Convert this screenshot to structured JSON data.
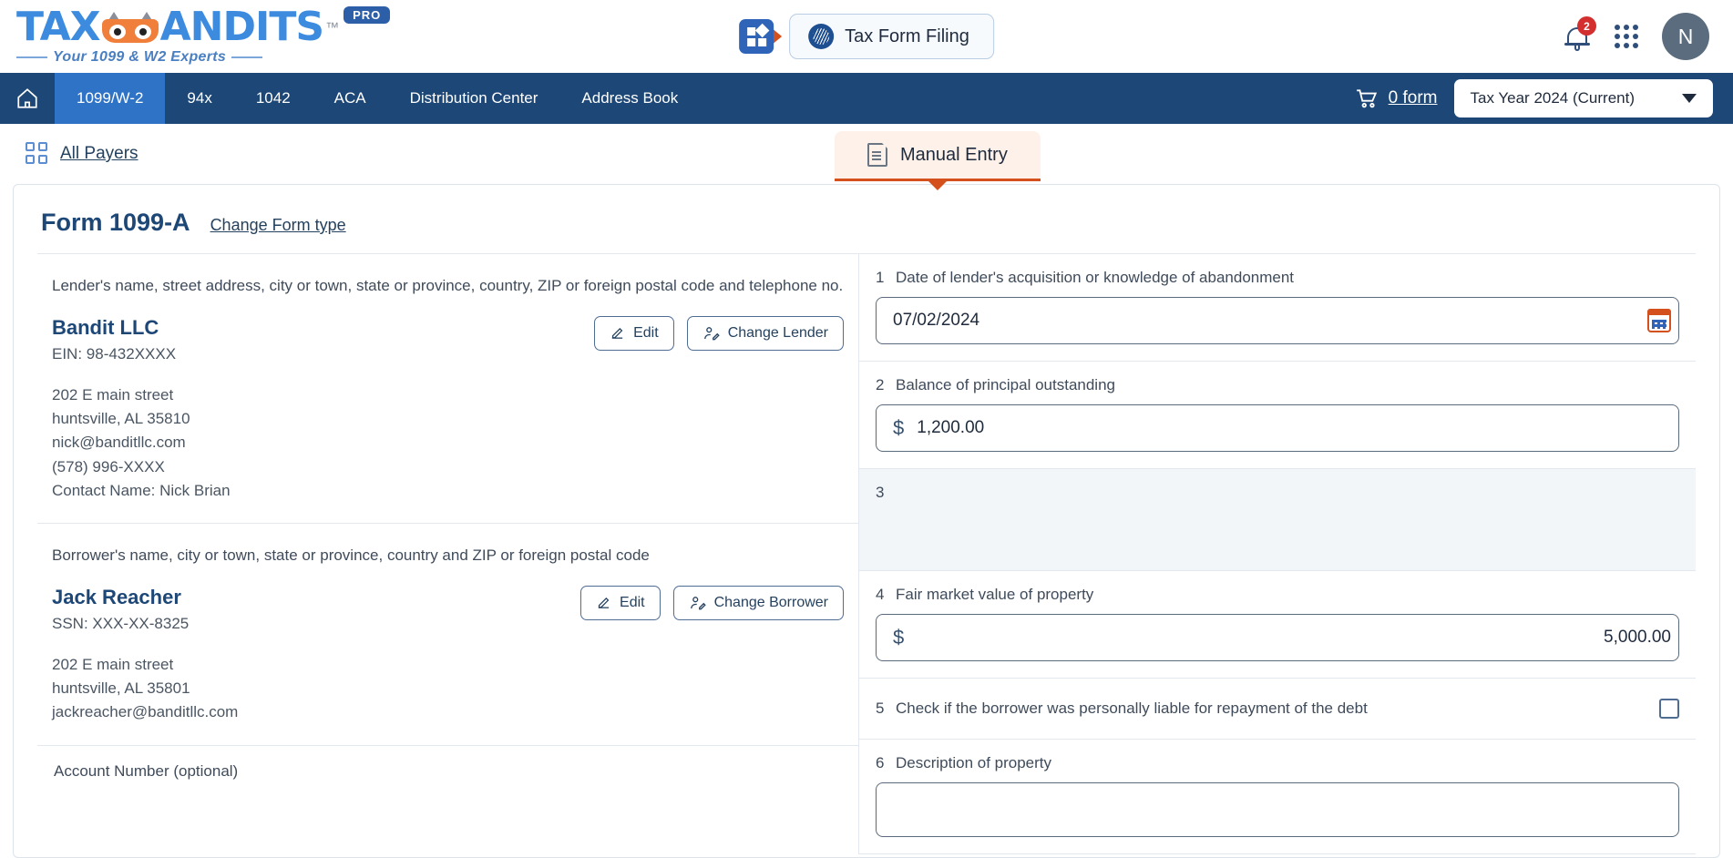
{
  "brand": {
    "logo_text_1": "TAX",
    "logo_text_2": "ANDITS",
    "trademark": "™",
    "pro_badge": "PRO",
    "tagline": "Your 1099 & W2 Experts"
  },
  "header": {
    "app_switcher_icon": "app-grid-icon",
    "tax_form_filing_label": "Tax Form Filing",
    "tax_form_filing_icon": "irs-seal-icon",
    "notification_icon": "bell-icon",
    "notification_count": "2",
    "apps_icon": "nine-dots-icon",
    "avatar_initial": "N"
  },
  "nav": {
    "home_icon": "home-icon",
    "items": [
      {
        "label": "1099/W-2",
        "active": true
      },
      {
        "label": "94x",
        "active": false
      },
      {
        "label": "1042",
        "active": false
      },
      {
        "label": "ACA",
        "active": false
      },
      {
        "label": "Distribution Center",
        "active": false
      },
      {
        "label": "Address Book",
        "active": false
      }
    ],
    "cart_icon": "shopping-cart-icon",
    "cart_label": "0 form",
    "tax_year": "Tax Year 2024 (Current)",
    "tax_year_caret": "chevron-down-icon"
  },
  "subheader": {
    "all_payers_icon": "grid-squares-icon",
    "all_payers_label": "All Payers",
    "manual_entry_icon": "document-icon",
    "manual_entry_label": "Manual Entry"
  },
  "form": {
    "title": "Form 1099-A",
    "change_form_type": "Change Form type"
  },
  "lender": {
    "section_label": "Lender's name, street address, city or town, state or province, country, ZIP or foreign postal code and telephone no.",
    "name": "Bandit LLC",
    "ein": "EIN: 98-432XXXX",
    "edit_label": "Edit",
    "edit_icon": "pencil-icon",
    "change_label": "Change Lender",
    "change_icon": "user-edit-icon",
    "address_lines": [
      "202 E main street",
      "huntsville, AL 35810",
      "nick@banditllc.com",
      "(578) 996-XXXX",
      "Contact Name: Nick Brian"
    ]
  },
  "borrower": {
    "section_label": "Borrower's name, city or town, state or province, country and ZIP or foreign postal code",
    "name": "Jack Reacher",
    "ssn": "SSN: XXX-XX-8325",
    "edit_label": "Edit",
    "edit_icon": "pencil-icon",
    "change_label": "Change Borrower",
    "change_icon": "user-edit-icon",
    "address_lines": [
      "202 E main street",
      "huntsville, AL 35801",
      "jackreacher@banditllc.com"
    ]
  },
  "account": {
    "partial_label": "Account Number (optional)"
  },
  "fields": {
    "f1": {
      "num": "1",
      "label": "Date of lender's acquisition or knowledge of abandonment",
      "value": "07/02/2024",
      "icon": "calendar-icon"
    },
    "f2": {
      "num": "2",
      "label": "Balance of principal outstanding",
      "currency": "$",
      "value": "1,200.00"
    },
    "f3": {
      "num": "3",
      "label": ""
    },
    "f4": {
      "num": "4",
      "label": "Fair market value of property",
      "currency": "$",
      "value": "5,000.00"
    },
    "f5": {
      "num": "5",
      "label": "Check if the borrower was personally liable for repayment of the debt",
      "checked": false
    },
    "f6": {
      "num": "6",
      "label": "Description of property",
      "value": ""
    }
  },
  "colors": {
    "nav_blue": "#1d4776",
    "nav_active": "#2f73c7",
    "accent_orange": "#d4511e",
    "brand_blue": "#3d8bde",
    "badge_red": "#d32f2f"
  }
}
